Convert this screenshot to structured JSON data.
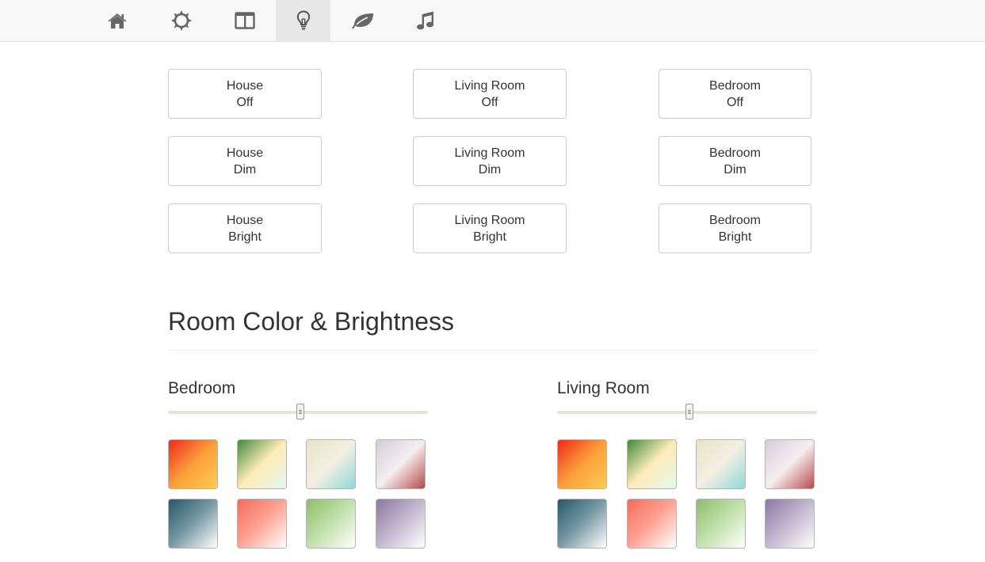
{
  "nav": {
    "tabs": [
      {
        "icon": "home-icon",
        "active": false
      },
      {
        "icon": "sun-icon",
        "active": false
      },
      {
        "icon": "columns-icon",
        "active": false
      },
      {
        "icon": "lightbulb-icon",
        "active": true
      },
      {
        "icon": "leaf-icon",
        "active": false
      },
      {
        "icon": "music-icon",
        "active": false
      }
    ]
  },
  "scenes": [
    {
      "room": "House",
      "state": "Off"
    },
    {
      "room": "Living Room",
      "state": "Off"
    },
    {
      "room": "Bedroom",
      "state": "Off"
    },
    {
      "room": "House",
      "state": "Dim"
    },
    {
      "room": "Living Room",
      "state": "Dim"
    },
    {
      "room": "Bedroom",
      "state": "Dim"
    },
    {
      "room": "House",
      "state": "Bright"
    },
    {
      "room": "Living Room",
      "state": "Bright"
    },
    {
      "room": "Bedroom",
      "state": "Bright"
    }
  ],
  "color_section": {
    "title": "Room Color & Brightness",
    "rooms": [
      {
        "name": "Bedroom",
        "brightness_percent": 51
      },
      {
        "name": "Living Room",
        "brightness_percent": 51
      }
    ]
  },
  "swatch_gradients": [
    [
      "#ee2a1a",
      "#f99e3a",
      "#fecd52"
    ],
    [
      "#3f8a3c",
      "#fdebb8",
      "#e3f8f3"
    ],
    [
      "#e9e3c6",
      "#f3efe2",
      "#8fd9d9"
    ],
    [
      "#d6cbda",
      "#f5eef0",
      "#b44b4b"
    ],
    [
      "#255869",
      "#7a9aa6",
      "#ffffff"
    ],
    [
      "#f6695a",
      "#fba596",
      "#ffffff"
    ],
    [
      "#8dbe6a",
      "#c2e0ad",
      "#ffffff"
    ],
    [
      "#8c77a2",
      "#c4b8cf",
      "#ffffff"
    ]
  ]
}
